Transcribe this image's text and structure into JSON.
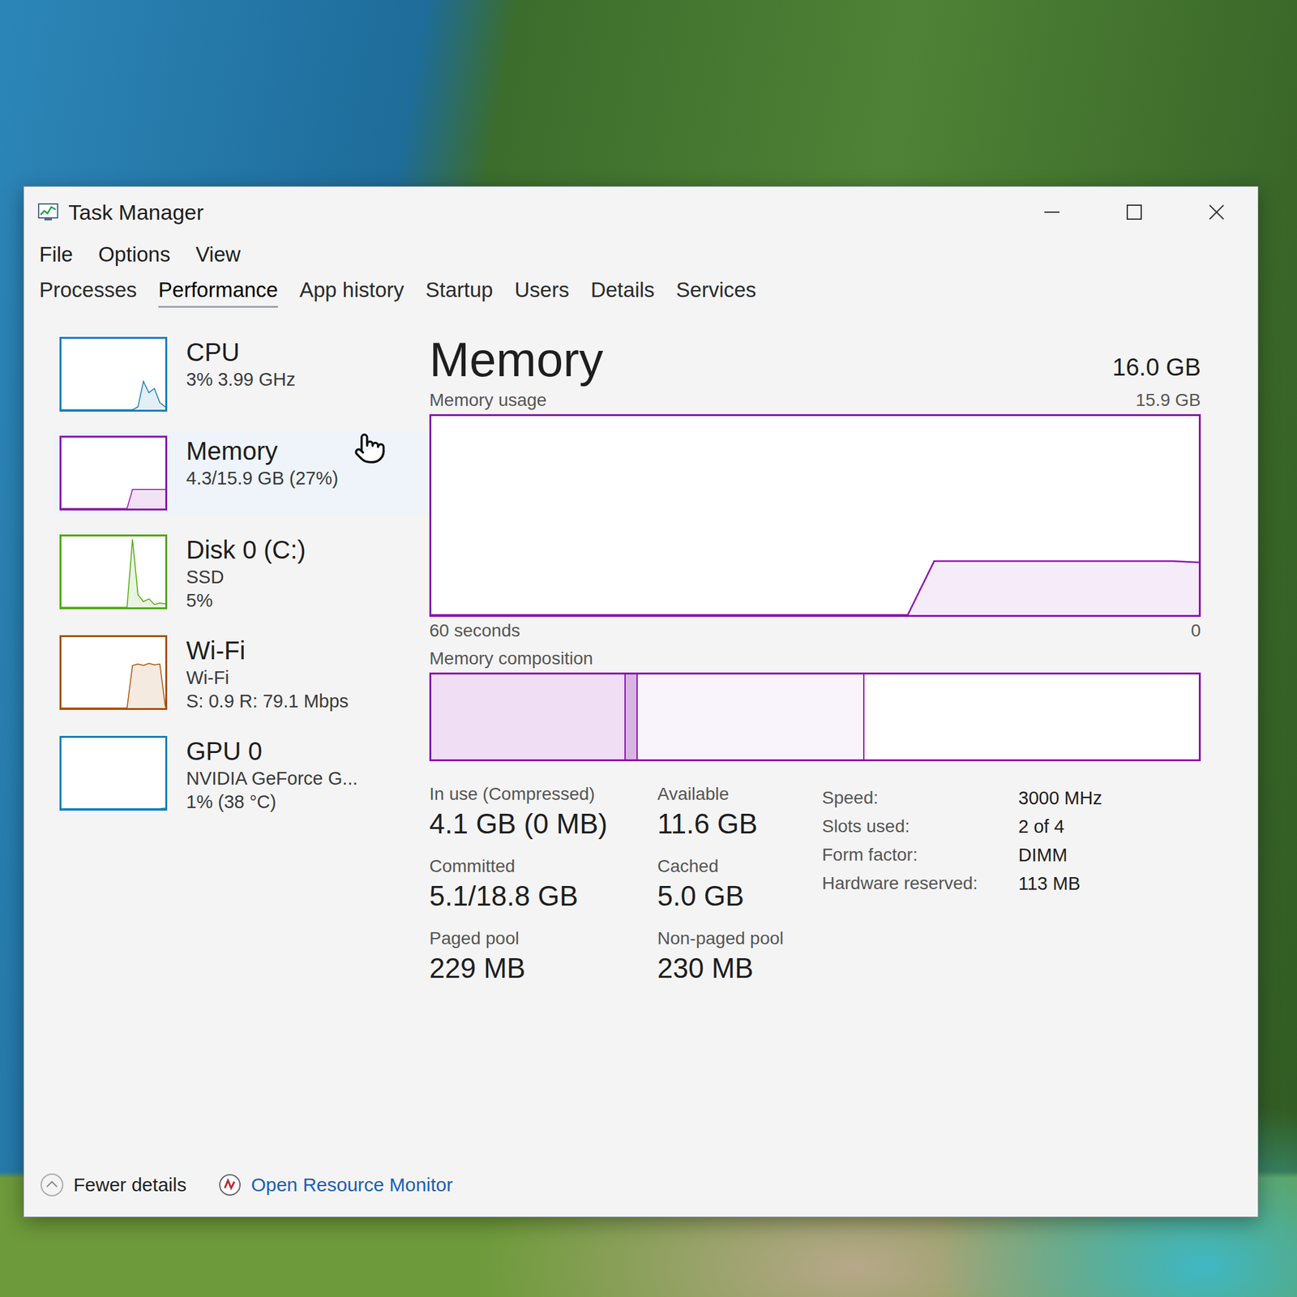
{
  "window": {
    "title": "Task Manager"
  },
  "menu": [
    "File",
    "Options",
    "View"
  ],
  "tabs": [
    {
      "label": "Processes",
      "selected": false
    },
    {
      "label": "Performance",
      "selected": true
    },
    {
      "label": "App history",
      "selected": false
    },
    {
      "label": "Startup",
      "selected": false
    },
    {
      "label": "Users",
      "selected": false
    },
    {
      "label": "Details",
      "selected": false
    },
    {
      "label": "Services",
      "selected": false
    }
  ],
  "sidebar": {
    "items": [
      {
        "name": "CPU",
        "details": [
          "3% 3.99 GHz"
        ],
        "color": "#117dbb",
        "selected": false,
        "graph": [
          0,
          0,
          0,
          0,
          0,
          0,
          0,
          0,
          0,
          0,
          0,
          0,
          0,
          0,
          4,
          40,
          24,
          30,
          10,
          4
        ]
      },
      {
        "name": "Memory",
        "details": [
          "4.3/15.9 GB (27%)"
        ],
        "color": "#8b12ae",
        "selected": true,
        "graph": [
          0,
          0,
          0,
          0,
          0,
          0,
          0,
          0,
          0,
          0,
          0,
          0,
          0,
          27,
          27,
          27,
          27,
          27,
          27,
          27
        ]
      },
      {
        "name": "Disk 0 (C:)",
        "details": [
          "SSD",
          "5%"
        ],
        "color": "#4da60c",
        "selected": false,
        "graph": [
          0,
          0,
          0,
          0,
          0,
          0,
          0,
          0,
          0,
          0,
          0,
          0,
          0,
          96,
          18,
          8,
          12,
          4,
          6,
          5
        ]
      },
      {
        "name": "Wi-Fi",
        "details": [
          "Wi-Fi",
          "S: 0.9 R: 79.1 Mbps"
        ],
        "color": "#a74f01",
        "selected": false,
        "graph": [
          0,
          0,
          0,
          0,
          0,
          0,
          0,
          0,
          0,
          0,
          0,
          0,
          0,
          60,
          62,
          60,
          63,
          61,
          62,
          2
        ]
      },
      {
        "name": "GPU 0",
        "details": [
          "NVIDIA GeForce G...",
          "1% (38 °C)"
        ],
        "color": "#117dbb",
        "selected": false,
        "graph": [
          0,
          0,
          0,
          0,
          0,
          0,
          0,
          0,
          0,
          0,
          0,
          0,
          0,
          0,
          0,
          0,
          0,
          0,
          0,
          1
        ]
      }
    ]
  },
  "detail": {
    "title": "Memory",
    "capacity": "16.0 GB",
    "usage_chart": {
      "label": "Memory usage",
      "max": "15.9 GB",
      "max_value": 15.9,
      "time": "60 seconds",
      "min": "0",
      "values": [
        0,
        0,
        0,
        0,
        0,
        0,
        0,
        0,
        0,
        0,
        0,
        0,
        0,
        0,
        0,
        0,
        0,
        0,
        0,
        4.3,
        4.3,
        4.3,
        4.3,
        4.3,
        4.3,
        4.3,
        4.3,
        4.3,
        4.3,
        4.2
      ]
    },
    "composition": {
      "label": "Memory composition",
      "segments": [
        {
          "kind": "in-use",
          "level": 0.253
        },
        {
          "kind": "modified",
          "level": 0.016
        },
        {
          "kind": "standby",
          "level": 0.295
        },
        {
          "kind": "free",
          "level": 0.436
        }
      ]
    },
    "stats": [
      {
        "label": "In use (Compressed)",
        "value": "4.1 GB (0 MB)"
      },
      {
        "label": "Available",
        "value": "11.6 GB"
      },
      {
        "label": "Committed",
        "value": "5.1/18.8 GB"
      },
      {
        "label": "Cached",
        "value": "5.0 GB"
      },
      {
        "label": "Paged pool",
        "value": "229 MB"
      },
      {
        "label": "Non-paged pool",
        "value": "230 MB"
      }
    ],
    "specs": [
      {
        "label": "Speed:",
        "value": "3000 MHz"
      },
      {
        "label": "Slots used:",
        "value": "2 of 4"
      },
      {
        "label": "Form factor:",
        "value": "DIMM"
      },
      {
        "label": "Hardware reserved:",
        "value": "113 MB"
      }
    ]
  },
  "footer": {
    "fewer_details": "Fewer details",
    "resource_monitor": "Open Resource Monitor"
  }
}
